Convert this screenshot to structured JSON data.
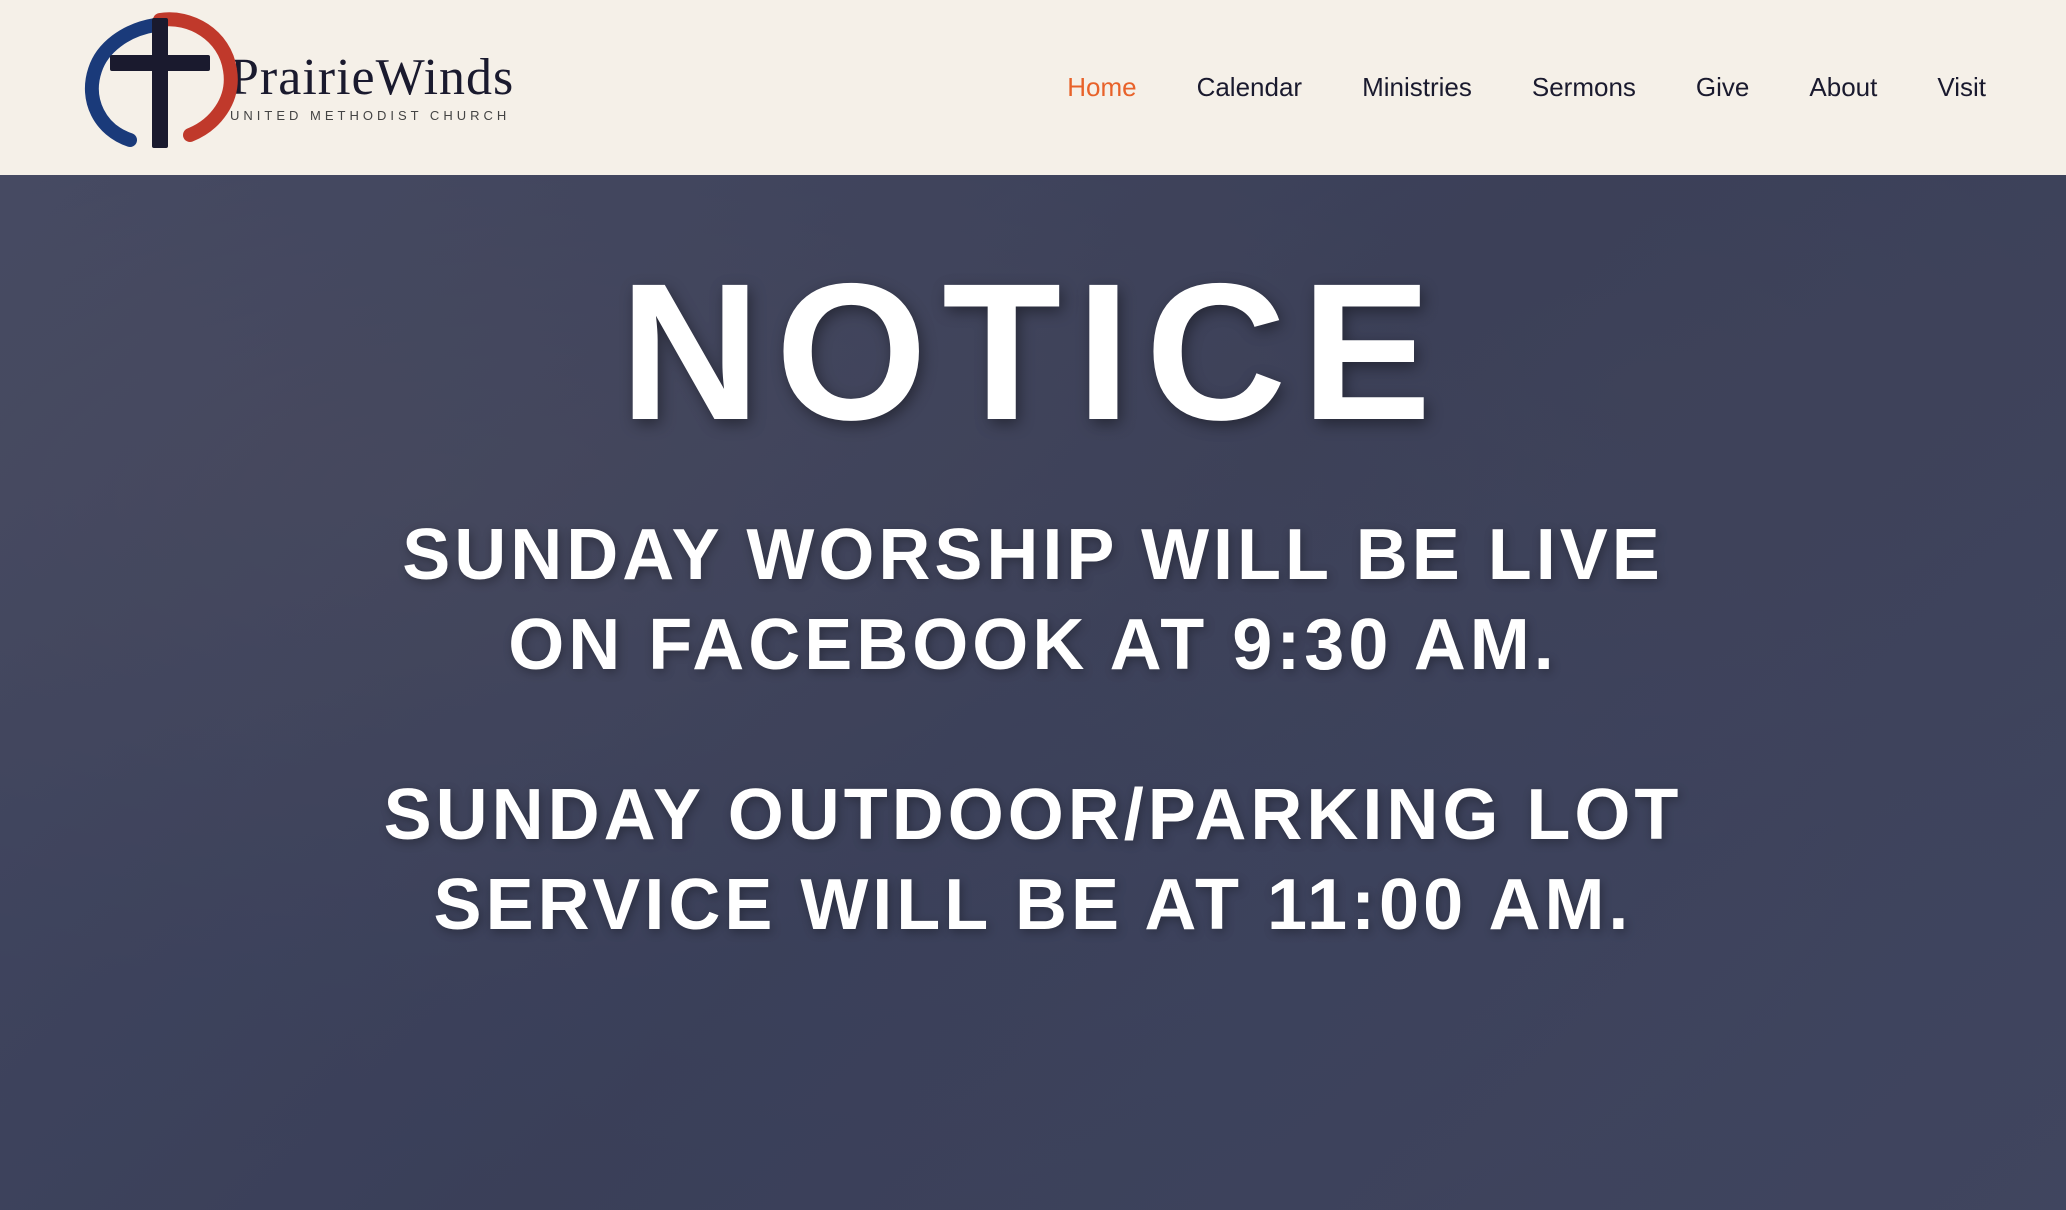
{
  "header": {
    "logo": {
      "main_text": "PrairieWinds",
      "sub_text": "UNITED METHODIST CHURCH"
    },
    "nav": {
      "items": [
        {
          "label": "Home",
          "active": true
        },
        {
          "label": "Calendar",
          "active": false
        },
        {
          "label": "Ministries",
          "active": false
        },
        {
          "label": "Sermons",
          "active": false
        },
        {
          "label": "Give",
          "active": false
        },
        {
          "label": "About",
          "active": false
        },
        {
          "label": "Visit",
          "active": false
        }
      ]
    }
  },
  "hero": {
    "notice_title": "NOTICE",
    "text_line1": "SUNDAY WORSHIP WILL BE LIVE\nON FACEBOOK AT 9:30 AM.",
    "text_line2": "SUNDAY OUTDOOR/PARKING LOT\nSERVICE WILL BE AT 11:00 AM."
  },
  "colors": {
    "nav_active": "#e8622a",
    "header_bg": "#f5f0e8",
    "hero_bg": "#5a5f7a"
  }
}
